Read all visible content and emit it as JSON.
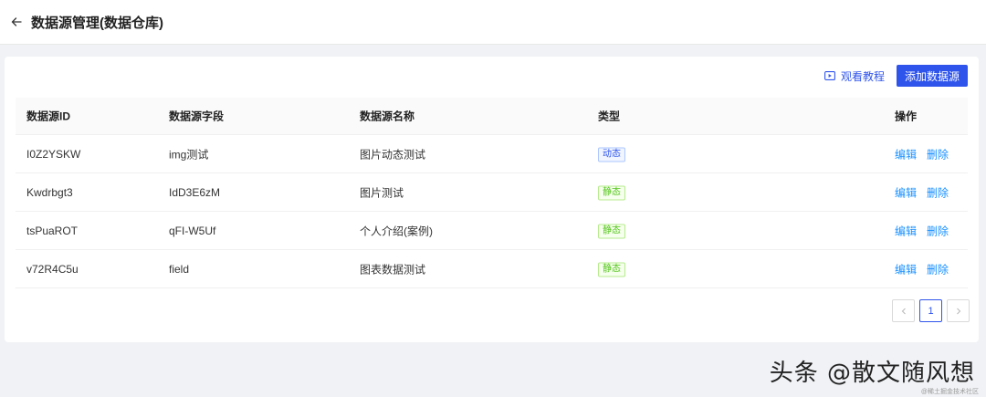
{
  "header": {
    "title": "数据源管理(数据仓库)"
  },
  "toolbar": {
    "tutorial_label": "观看教程",
    "add_label": "添加数据源"
  },
  "table": {
    "columns": [
      "数据源ID",
      "数据源字段",
      "数据源名称",
      "类型",
      "操作"
    ],
    "rows": [
      {
        "id": "I0Z2YSKW",
        "field": "img测试",
        "name": "图片动态测试",
        "type": "动态",
        "type_kind": "dynamic"
      },
      {
        "id": "Kwdrbgt3",
        "field": "IdD3E6zM",
        "name": "图片测试",
        "type": "静态",
        "type_kind": "static"
      },
      {
        "id": "tsPuaROT",
        "field": "qFI-W5Uf",
        "name": "个人介绍(案例)",
        "type": "静态",
        "type_kind": "static"
      },
      {
        "id": "v72R4C5u",
        "field": "field",
        "name": "图表数据测试",
        "type": "静态",
        "type_kind": "static"
      }
    ],
    "actions": {
      "edit": "编辑",
      "delete": "删除"
    }
  },
  "pagination": {
    "current_page": "1",
    "prev_icon": "chevron-left-icon",
    "next_icon": "chevron-right-icon"
  },
  "watermark": {
    "text": "头条 @散文随风想",
    "sub": "@稀土掘金技术社区"
  },
  "colors": {
    "primary": "#2f54eb",
    "link": "#1890ff",
    "static_tag": "#52c41a"
  }
}
